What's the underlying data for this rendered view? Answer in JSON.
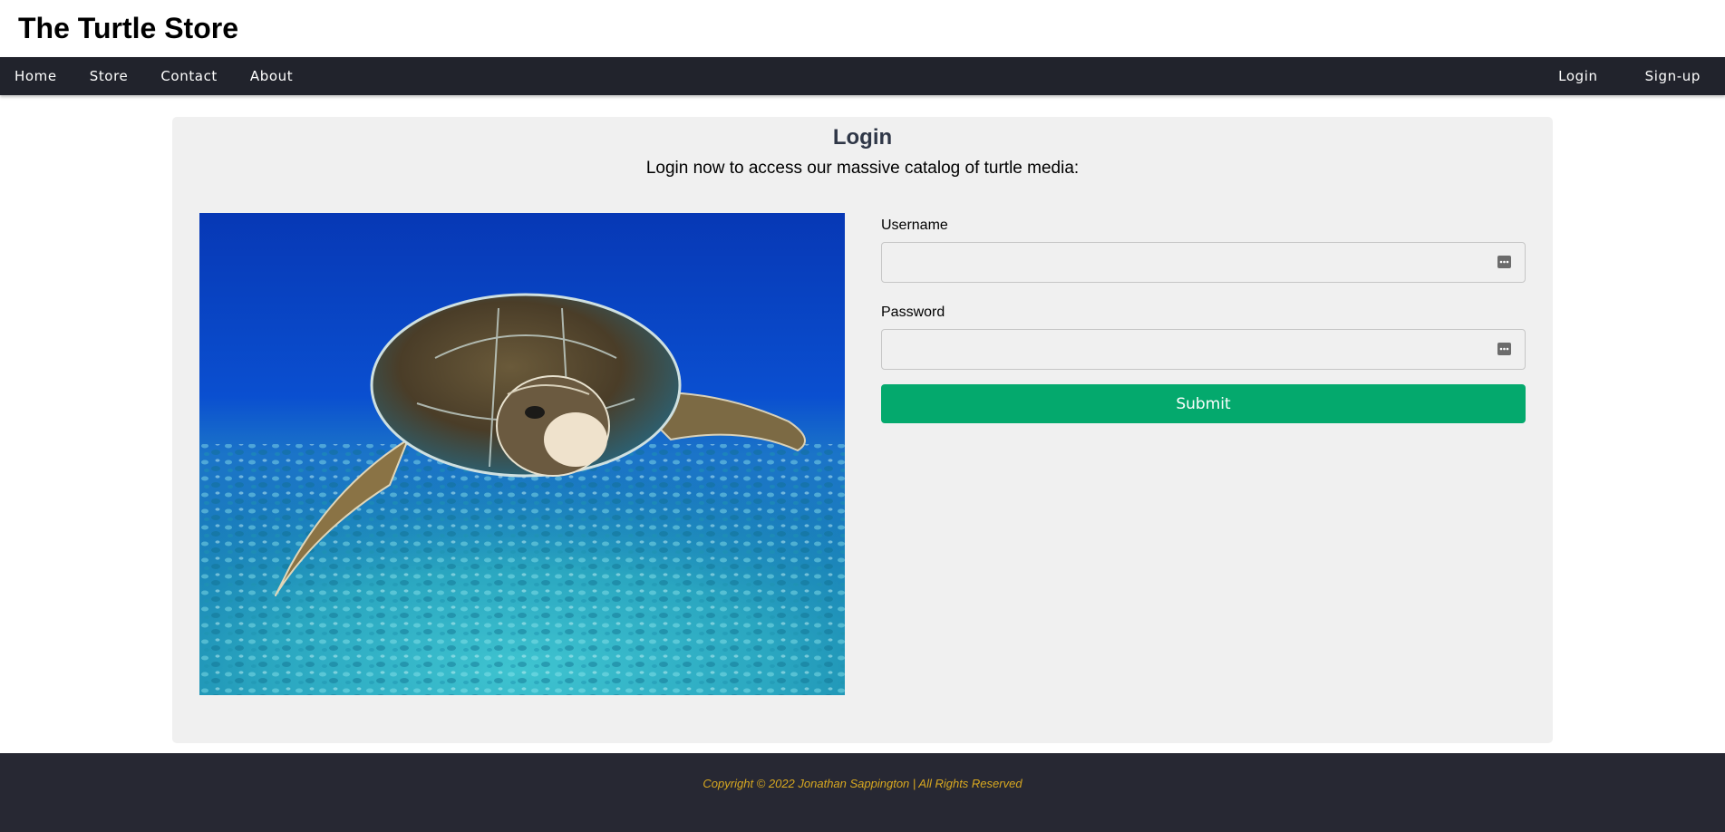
{
  "site": {
    "title": "The Turtle Store"
  },
  "nav": {
    "left": [
      "Home",
      "Store",
      "Contact",
      "About"
    ],
    "right": [
      "Login",
      "Sign-up"
    ]
  },
  "login": {
    "heading": "Login",
    "subtitle": "Login now to access our massive catalog of turtle media:",
    "username_label": "Username",
    "username_value": "",
    "password_label": "Password",
    "password_value": "",
    "submit_label": "Submit"
  },
  "icons": {
    "field_icon": "password-key-icon",
    "photo": "sea-turtle-photo"
  },
  "colors": {
    "nav_bg": "#21232c",
    "card_bg": "#f0f0f0",
    "submit_bg": "#04a96d",
    "footer_bg": "#272833",
    "footer_text": "#d8a820",
    "heading": "#2f3747"
  },
  "footer": {
    "copyright": "Copyright © 2022 Jonathan Sappington | All Rights Reserved"
  }
}
